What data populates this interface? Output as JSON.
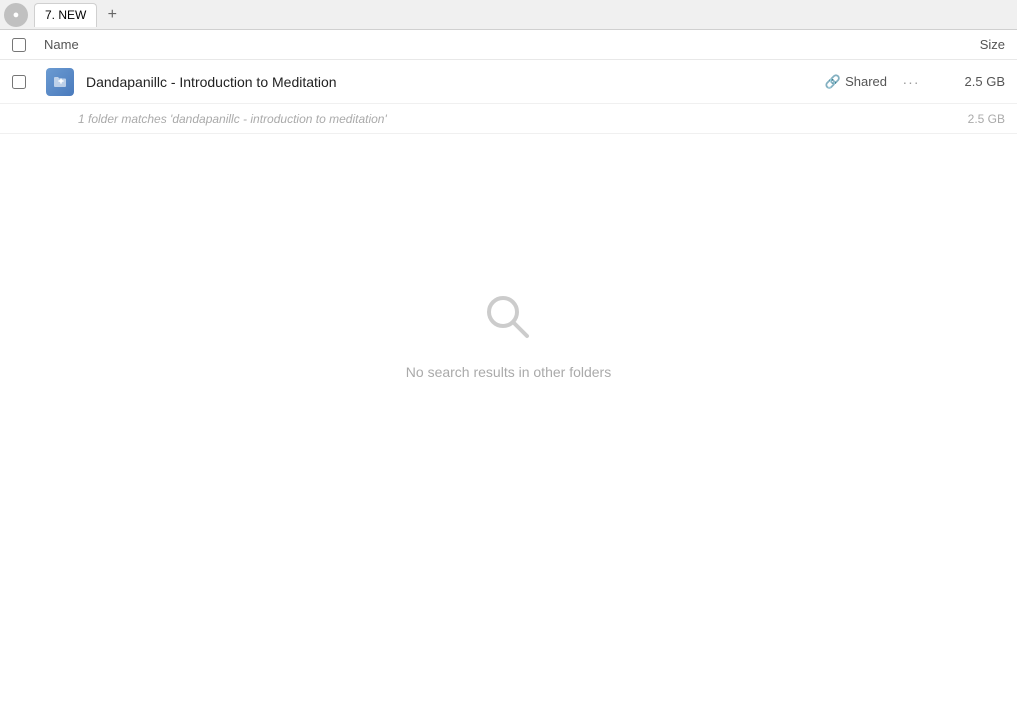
{
  "tabBar": {
    "backButton": "◀",
    "tab": {
      "label": "7. NEW",
      "active": true
    },
    "addTabLabel": "+"
  },
  "columnHeader": {
    "nameLabel": "Name",
    "sizeLabel": "Size"
  },
  "fileRow": {
    "fileName": "Dandapanillc - Introduction to Meditation",
    "sharedLabel": "Shared",
    "moreLabel": "···",
    "fileSize": "2.5 GB",
    "iconSymbol": "🔗"
  },
  "matchInfo": {
    "text": "1 folder matches 'dandapanillc - introduction to meditation'",
    "size": "2.5 GB"
  },
  "emptyState": {
    "message": "No search results in other folders"
  },
  "colors": {
    "accent": "#4a7abc",
    "sharedColor": "#555555",
    "muted": "#aaaaaa"
  }
}
